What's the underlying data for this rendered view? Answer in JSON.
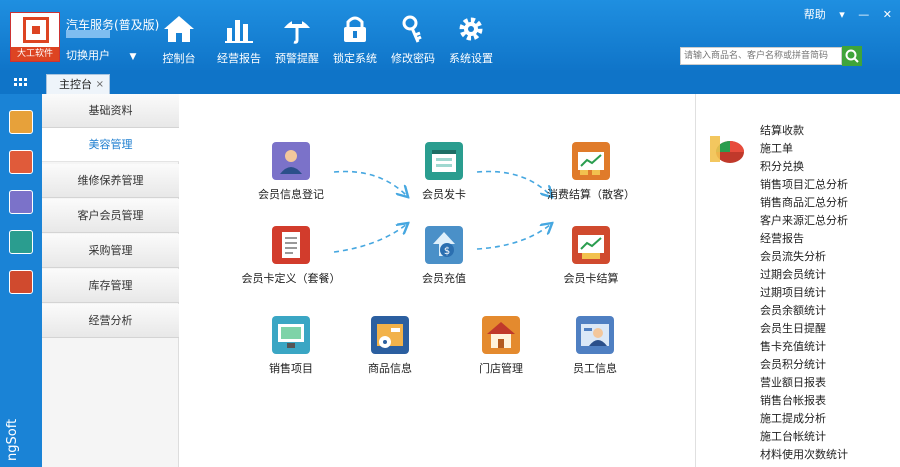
{
  "app": {
    "logo_text": "大工软件",
    "name": "汽车服务(普及版)",
    "switch_user": "切换用户",
    "brand_vertical": "ngSoft"
  },
  "toolbar": [
    {
      "label": "控制台",
      "icon": "home-icon"
    },
    {
      "label": "经营报告",
      "icon": "bar-chart-icon"
    },
    {
      "label": "预警提醒",
      "icon": "alert-icon"
    },
    {
      "label": "锁定系统",
      "icon": "lock-icon"
    },
    {
      "label": "修改密码",
      "icon": "key-icon"
    },
    {
      "label": "系统设置",
      "icon": "gear-icon"
    }
  ],
  "window_controls": {
    "help": "帮助",
    "menu": "▾",
    "minimize": "—",
    "close": "✕"
  },
  "search": {
    "placeholder": "请输入商品名、客户名称或拼音简码",
    "button_icon": "search-icon"
  },
  "tabs": [
    {
      "label": "主控台",
      "close": "×"
    }
  ],
  "menu": {
    "items": [
      "基础资料",
      "美容管理",
      "维修保养管理",
      "客户会员管理",
      "采购管理",
      "库存管理",
      "经营分析"
    ],
    "active_index": 1
  },
  "workflow": {
    "nodes": [
      {
        "label": "会员信息登记",
        "icon": "member-register-icon",
        "color": "#7b72c9"
      },
      {
        "label": "会员发卡",
        "icon": "card-issue-icon",
        "color": "#2a9d8f"
      },
      {
        "label": "消费结算（散客）",
        "icon": "checkout-icon",
        "color": "#e07b2a"
      },
      {
        "label": "会员卡定义（套餐）",
        "icon": "card-define-icon",
        "color": "#d23c2c"
      },
      {
        "label": "会员充值",
        "icon": "recharge-icon",
        "color": "#4a90c8"
      },
      {
        "label": "会员卡结算",
        "icon": "card-settle-icon",
        "color": "#d04a2e"
      },
      {
        "label": "销售项目",
        "icon": "sales-item-icon",
        "color": "#3aa6c4"
      },
      {
        "label": "商品信息",
        "icon": "product-icon",
        "color": "#2b5fa0"
      },
      {
        "label": "门店管理",
        "icon": "store-icon",
        "color": "#e48a2e"
      },
      {
        "label": "员工信息",
        "icon": "staff-icon",
        "color": "#4f7fc2"
      }
    ]
  },
  "reports": {
    "icon": "pie-chart-icon",
    "items": [
      "结算收款",
      "施工单",
      "积分兑换",
      "销售项目汇总分析",
      "销售商品汇总分析",
      "客户来源汇总分析",
      "经营报告",
      "会员流失分析",
      "过期会员统计",
      "过期项目统计",
      "会员余额统计",
      "会员生日提醒",
      "售卡充值统计",
      "会员积分统计",
      "营业额日报表",
      "销售台帐报表",
      "施工提成分析",
      "施工台帐统计",
      "材料使用次数统计"
    ]
  },
  "rail_icons": [
    "chart-app-icon",
    "report-app-icon",
    "person-app-icon",
    "card-app-icon",
    "money-app-icon"
  ]
}
